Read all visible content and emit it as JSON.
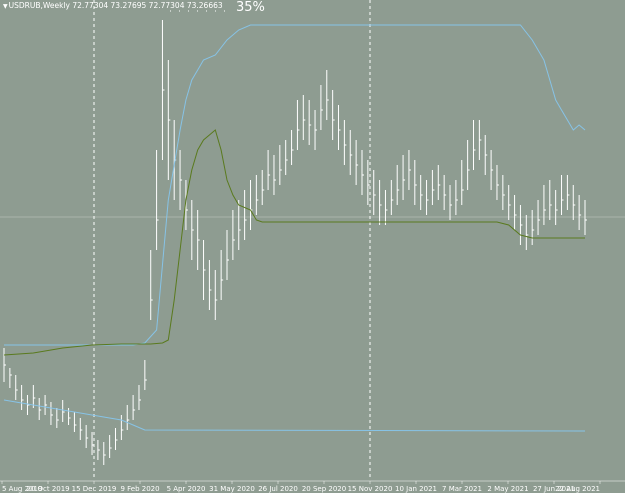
{
  "header": {
    "arrow_glyph": "▼",
    "symbol": "USDRUB,Weekly",
    "ohlc": "72.77304 73.27695 72.77304 73.26663",
    "zoom": "35%"
  },
  "colors": {
    "background": "#8e9c91",
    "bars": "#ffffff",
    "blue_line": "#87c3e6",
    "green_line": "#5a7a1e",
    "grid": "#ffffff",
    "bid_line": "#a9b5ab"
  },
  "chart_data": {
    "type": "line",
    "x_axis": {
      "tick_labels": [
        "5 Aug 2019",
        "20 Oct 2019",
        "15 Dec 2019",
        "9 Feb 2020",
        "5 Apr 2020",
        "31 May 2020",
        "26 Jul 2020",
        "20 Sep 2020",
        "15 Nov 2020",
        "10 Jan 2021",
        "7 Mar 2021",
        "2 May 2021",
        "27 Jun 2021",
        "22 Aug 2021"
      ]
    },
    "vertical_markers": [
      "15 Dec 2019",
      "15 Nov 2020"
    ],
    "bars": [
      [
        0,
        365,
        348,
        382
      ],
      [
        1,
        375,
        368,
        388
      ],
      [
        2,
        390,
        375,
        400
      ],
      [
        3,
        400,
        385,
        410
      ],
      [
        4,
        405,
        395,
        415
      ],
      [
        5,
        398,
        385,
        408
      ],
      [
        6,
        410,
        398,
        420
      ],
      [
        7,
        405,
        395,
        415
      ],
      [
        8,
        415,
        402,
        425
      ],
      [
        9,
        420,
        408,
        428
      ],
      [
        10,
        412,
        400,
        422
      ],
      [
        11,
        418,
        408,
        425
      ],
      [
        12,
        425,
        412,
        432
      ],
      [
        13,
        430,
        418,
        440
      ],
      [
        14,
        438,
        425,
        448
      ],
      [
        15,
        445,
        432,
        455
      ],
      [
        16,
        450,
        440,
        460
      ],
      [
        17,
        455,
        442,
        465
      ],
      [
        18,
        448,
        435,
        458
      ],
      [
        19,
        440,
        428,
        450
      ],
      [
        20,
        430,
        415,
        440
      ],
      [
        21,
        420,
        405,
        430
      ],
      [
        22,
        410,
        395,
        420
      ],
      [
        23,
        400,
        385,
        410
      ],
      [
        24,
        380,
        360,
        390
      ],
      [
        25,
        300,
        250,
        320
      ],
      [
        26,
        220,
        150,
        250
      ],
      [
        27,
        90,
        20,
        160
      ],
      [
        28,
        120,
        60,
        180
      ],
      [
        29,
        160,
        120,
        200
      ],
      [
        30,
        180,
        150,
        210
      ],
      [
        31,
        210,
        180,
        230
      ],
      [
        32,
        230,
        200,
        260
      ],
      [
        33,
        240,
        210,
        270
      ],
      [
        34,
        270,
        240,
        300
      ],
      [
        35,
        290,
        260,
        310
      ],
      [
        36,
        300,
        270,
        320
      ],
      [
        37,
        280,
        250,
        300
      ],
      [
        38,
        260,
        230,
        280
      ],
      [
        39,
        240,
        210,
        260
      ],
      [
        40,
        230,
        200,
        250
      ],
      [
        41,
        220,
        190,
        240
      ],
      [
        42,
        210,
        180,
        230
      ],
      [
        43,
        200,
        175,
        215
      ],
      [
        44,
        190,
        170,
        205
      ],
      [
        45,
        175,
        150,
        190
      ],
      [
        46,
        180,
        155,
        195
      ],
      [
        47,
        170,
        145,
        185
      ],
      [
        48,
        160,
        140,
        175
      ],
      [
        49,
        150,
        130,
        165
      ],
      [
        50,
        130,
        100,
        150
      ],
      [
        51,
        120,
        95,
        140
      ],
      [
        52,
        125,
        100,
        145
      ],
      [
        53,
        130,
        110,
        150
      ],
      [
        54,
        110,
        85,
        130
      ],
      [
        55,
        100,
        70,
        120
      ],
      [
        56,
        120,
        90,
        140
      ],
      [
        57,
        130,
        105,
        150
      ],
      [
        58,
        145,
        120,
        165
      ],
      [
        59,
        155,
        130,
        175
      ],
      [
        60,
        165,
        140,
        185
      ],
      [
        61,
        175,
        150,
        195
      ],
      [
        62,
        185,
        160,
        205
      ],
      [
        63,
        195,
        170,
        215
      ],
      [
        64,
        205,
        180,
        225
      ],
      [
        65,
        210,
        190,
        225
      ],
      [
        66,
        200,
        180,
        215
      ],
      [
        67,
        190,
        165,
        205
      ],
      [
        68,
        180,
        155,
        200
      ],
      [
        69,
        170,
        150,
        190
      ],
      [
        70,
        185,
        160,
        205
      ],
      [
        71,
        195,
        175,
        210
      ],
      [
        72,
        200,
        180,
        215
      ],
      [
        73,
        190,
        170,
        205
      ],
      [
        74,
        185,
        165,
        200
      ],
      [
        75,
        195,
        175,
        210
      ],
      [
        76,
        205,
        185,
        220
      ],
      [
        77,
        200,
        180,
        215
      ],
      [
        78,
        190,
        160,
        205
      ],
      [
        79,
        170,
        140,
        190
      ],
      [
        80,
        150,
        120,
        170
      ],
      [
        81,
        140,
        120,
        160
      ],
      [
        82,
        155,
        135,
        175
      ],
      [
        83,
        170,
        150,
        190
      ],
      [
        84,
        185,
        165,
        200
      ],
      [
        85,
        195,
        175,
        210
      ],
      [
        86,
        205,
        185,
        220
      ],
      [
        87,
        215,
        195,
        230
      ],
      [
        88,
        225,
        205,
        245
      ],
      [
        89,
        235,
        215,
        250
      ],
      [
        90,
        230,
        210,
        245
      ],
      [
        91,
        220,
        200,
        235
      ],
      [
        92,
        210,
        185,
        225
      ],
      [
        93,
        205,
        180,
        220
      ],
      [
        94,
        210,
        190,
        225
      ],
      [
        95,
        200,
        175,
        215
      ],
      [
        96,
        195,
        175,
        210
      ],
      [
        97,
        205,
        185,
        220
      ],
      [
        98,
        215,
        195,
        230
      ],
      [
        99,
        220,
        200,
        235
      ]
    ],
    "series": [
      {
        "color": "#87c3e6",
        "points": [
          [
            0,
            345
          ],
          [
            10,
            345
          ],
          [
            20,
            345
          ],
          [
            22,
            345
          ],
          [
            24,
            343
          ],
          [
            26,
            330
          ],
          [
            28,
            200
          ],
          [
            30,
            130
          ],
          [
            31,
            100
          ],
          [
            32,
            80
          ],
          [
            33,
            70
          ],
          [
            34,
            60
          ],
          [
            36,
            55
          ],
          [
            38,
            40
          ],
          [
            40,
            30
          ],
          [
            42,
            25
          ],
          [
            50,
            25
          ],
          [
            60,
            25
          ],
          [
            70,
            25
          ],
          [
            80,
            25
          ],
          [
            88,
            25
          ],
          [
            90,
            40
          ],
          [
            92,
            60
          ],
          [
            93,
            80
          ],
          [
            94,
            100
          ],
          [
            95,
            110
          ],
          [
            96,
            120
          ],
          [
            97,
            130
          ],
          [
            98,
            125
          ],
          [
            99,
            130
          ]
        ]
      },
      {
        "color": "#87c3e6",
        "points": [
          [
            0,
            400
          ],
          [
            5,
            405
          ],
          [
            10,
            410
          ],
          [
            15,
            415
          ],
          [
            18,
            418
          ],
          [
            20,
            420
          ],
          [
            22,
            425
          ],
          [
            24,
            430
          ],
          [
            99,
            431
          ]
        ]
      },
      {
        "color": "#5a7a1e",
        "points": [
          [
            0,
            355
          ],
          [
            5,
            353
          ],
          [
            10,
            348
          ],
          [
            15,
            345
          ],
          [
            20,
            344
          ],
          [
            25,
            344
          ],
          [
            27,
            343
          ],
          [
            28,
            340
          ],
          [
            29,
            300
          ],
          [
            30,
            250
          ],
          [
            31,
            200
          ],
          [
            32,
            170
          ],
          [
            33,
            150
          ],
          [
            34,
            140
          ],
          [
            35,
            135
          ],
          [
            36,
            130
          ],
          [
            37,
            150
          ],
          [
            38,
            180
          ],
          [
            39,
            195
          ],
          [
            40,
            205
          ],
          [
            42,
            210
          ],
          [
            43,
            220
          ],
          [
            44,
            222
          ],
          [
            50,
            222
          ],
          [
            60,
            222
          ],
          [
            70,
            222
          ],
          [
            80,
            222
          ],
          [
            84,
            222
          ],
          [
            86,
            225
          ],
          [
            88,
            235
          ],
          [
            90,
            238
          ],
          [
            99,
            238
          ]
        ]
      }
    ]
  }
}
